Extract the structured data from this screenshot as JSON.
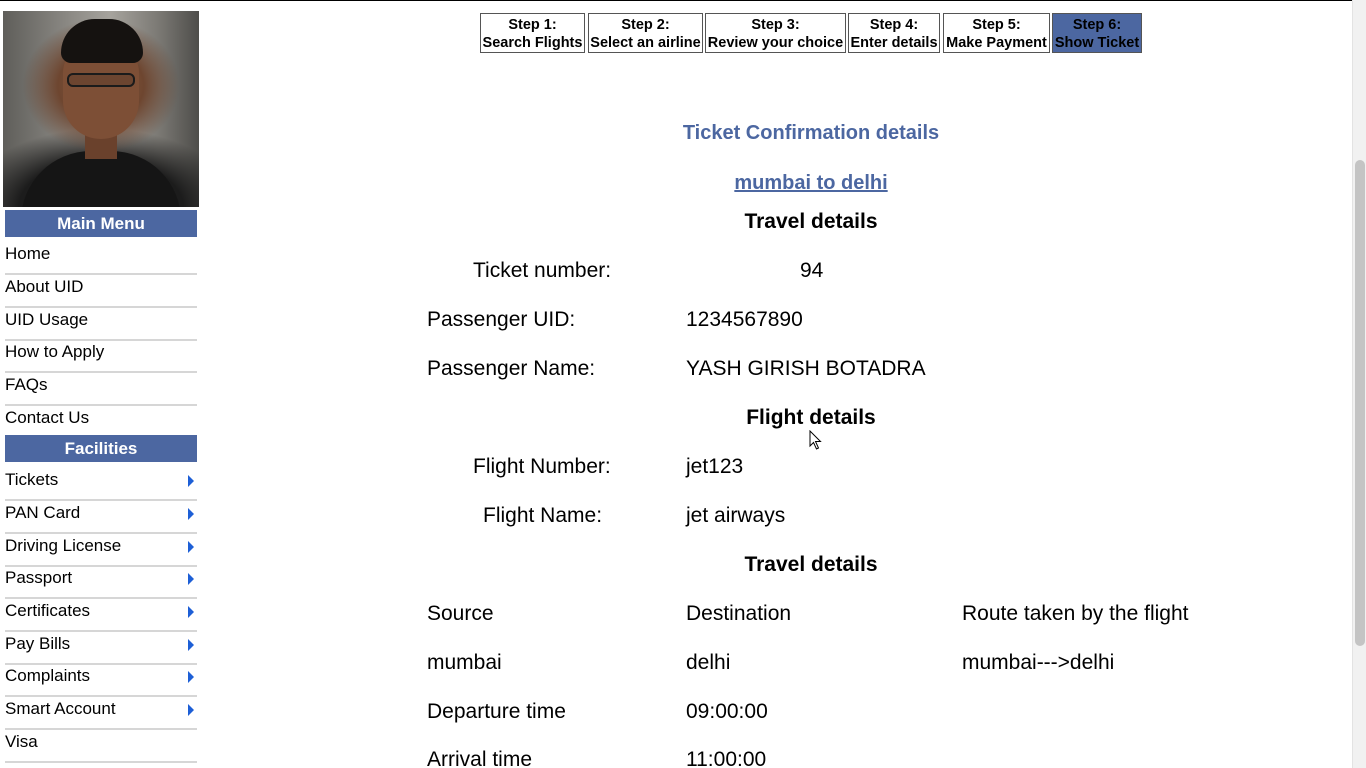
{
  "sidebar": {
    "main_menu_title": "Main Menu",
    "main_menu": [
      "Home",
      "About UID",
      "UID Usage",
      "How to Apply",
      "FAQs",
      "Contact Us"
    ],
    "facilities_title": "Facilities",
    "facilities": [
      "Tickets",
      "PAN Card",
      "Driving License",
      "Passport",
      "Certificates",
      "Pay Bills",
      "Complaints",
      "Smart Account",
      "Visa"
    ]
  },
  "steps": [
    {
      "num": "Step 1:",
      "label": "Search Flights"
    },
    {
      "num": "Step 2:",
      "label": "Select an airline"
    },
    {
      "num": "Step 3:",
      "label": "Review your choice"
    },
    {
      "num": "Step 4:",
      "label": "Enter details"
    },
    {
      "num": "Step 5:",
      "label": "Make Payment"
    },
    {
      "num": "Step 6:",
      "label": "Show Ticket"
    }
  ],
  "active_step_color": "#4c67a1",
  "main": {
    "title": "Ticket Confirmation details",
    "route": "mumbai to delhi",
    "travel_head": "Travel details",
    "ticket_label": "Ticket number:",
    "ticket_value": "94",
    "uid_label": "Passenger UID:",
    "uid_value": "1234567890",
    "name_label": "Passenger Name:",
    "name_value": "YASH GIRISH BOTADRA",
    "flight_head": "Flight details",
    "flight_number_label": "Flight Number:",
    "flight_number_value": "jet123",
    "flight_name_label": "Flight Name:",
    "flight_name_value": "jet airways",
    "travel_head2": "Travel details",
    "source_label": "Source",
    "dest_label": "Destination",
    "route_label": "Route taken by the flight",
    "source_value": "mumbai",
    "dest_value": "delhi",
    "route_value": "mumbai--->delhi",
    "departure_label": "Departure time",
    "departure_value": "09:00:00",
    "arrival_label": "Arrival time",
    "arrival_value": "11:00:00"
  }
}
